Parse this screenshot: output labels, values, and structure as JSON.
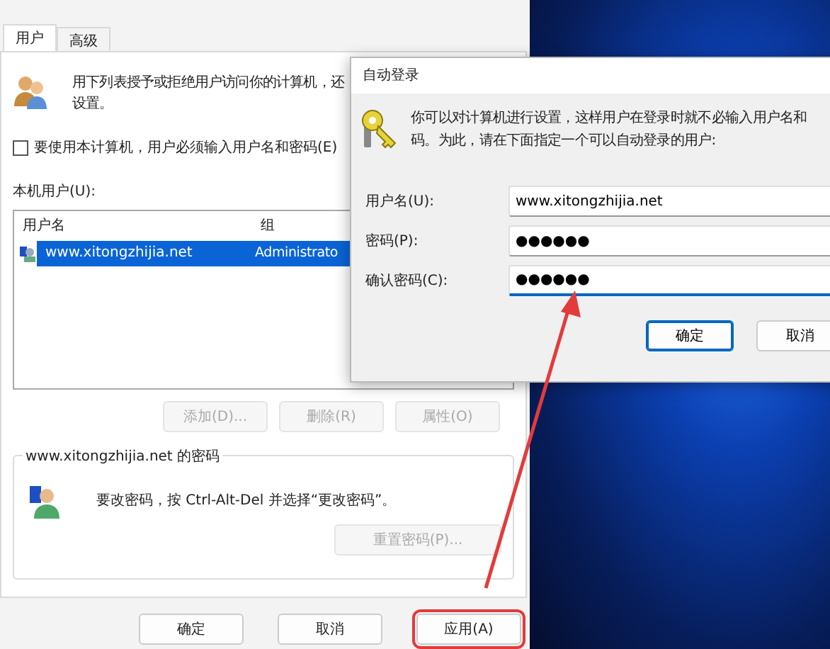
{
  "main_window": {
    "tabs": [
      {
        "label": "用户",
        "selected": true
      },
      {
        "label": "高级",
        "selected": false
      }
    ],
    "intro_lines": [
      "用下列表授予或拒绝用户访问你的计算机，还",
      "设置。"
    ],
    "require_password": {
      "label": "要使用本计算机，用户必须输入用户名和密码(E)",
      "checked": false
    },
    "users_label": "本机用户(U):",
    "users_table": {
      "columns": [
        "用户名",
        "组"
      ],
      "rows": [
        {
          "cells": [
            "www.xitongzhijia.net",
            "Administrato"
          ],
          "selected": true
        }
      ]
    },
    "list_buttons": [
      {
        "label": "添加(D)...",
        "disabled": true
      },
      {
        "label": "删除(R)",
        "disabled": true
      },
      {
        "label": "属性(O)",
        "disabled": true
      }
    ],
    "password_group": {
      "title": "www.xitongzhijia.net 的密码",
      "text": "要改密码，按 Ctrl-Alt-Del 并选择“更改密码”。",
      "button": {
        "label": "重置密码(P)...",
        "disabled": true
      }
    },
    "buttons": [
      {
        "label": "确定",
        "highlighted": false
      },
      {
        "label": "取消",
        "highlighted": false
      },
      {
        "label": "应用(A)",
        "highlighted": true
      }
    ]
  },
  "auto_login_dialog": {
    "title": "自动登录",
    "message_lines": [
      "你可以对计算机进行设置，这样用户在登录时就不必输入用户名和",
      "码。为此，请在下面指定一个可以自动登录的用户:"
    ],
    "fields": [
      {
        "label": "用户名(U):",
        "value": "www.xitongzhijia.net",
        "focused": false
      },
      {
        "label": "密码(P):",
        "value": "●●●●●●",
        "focused": false
      },
      {
        "label": "确认密码(C):",
        "value": "●●●●●●",
        "focused": true
      }
    ],
    "buttons": [
      {
        "label": "确定",
        "default": true
      },
      {
        "label": "取消",
        "default": false
      }
    ]
  }
}
